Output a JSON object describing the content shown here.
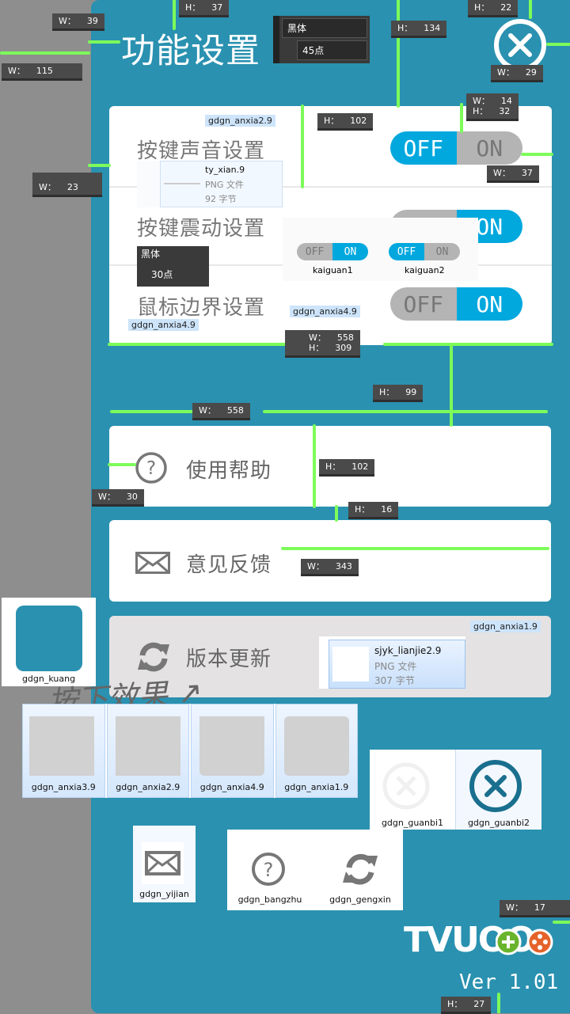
{
  "title": "功能设置",
  "close_icon": "close-circle-icon",
  "font_panel_large": {
    "font": "黑体",
    "size": "45点"
  },
  "font_panel_small": {
    "font": "黑体",
    "size": "30点"
  },
  "settings": [
    {
      "label": "按键声音设置",
      "off": "OFF",
      "on": "ON",
      "state": "off"
    },
    {
      "label": "按键震动设置",
      "off": "OFF",
      "on": "ON",
      "state": "on"
    },
    {
      "label": "鼠标边界设置",
      "off": "OFF",
      "on": "ON",
      "state": "on"
    }
  ],
  "buttons": [
    {
      "label": "使用帮助",
      "icon": "help-circle-icon"
    },
    {
      "label": "意见反馈",
      "icon": "envelope-icon"
    },
    {
      "label": "版本更新",
      "icon": "refresh-icon"
    }
  ],
  "file_labels": {
    "anxia2": "gdgn_anxia2.9",
    "anxia4a": "gdgn_anxia4.9",
    "anxia4b": "gdgn_anxia4.9",
    "anxia1": "gdgn_anxia1.9"
  },
  "ty_xian": {
    "name": "ty_xian.9",
    "type": "PNG 文件",
    "size": "92 字节"
  },
  "sjyk": {
    "name": "sjyk_lianjie2.9",
    "type": "PNG 文件",
    "size": "307 字节"
  },
  "kaiguan": [
    {
      "name": "kaiguan1",
      "off": "OFF",
      "on": "ON"
    },
    {
      "name": "kaiguan2",
      "off": "OFF",
      "on": "ON"
    }
  ],
  "kuang": "gdgn_kuang",
  "handwriting": "按下效果 ↗",
  "anxia_tiles": [
    "gdgn_anxia3.9",
    "gdgn_anxia2.9",
    "gdgn_anxia4.9",
    "gdgn_anxia1.9"
  ],
  "guanbi_tiles": [
    "gdgn_guanbi1",
    "gdgn_guanbi2"
  ],
  "yijian": "gdgn_yijian",
  "icon_tiles": [
    "gdgn_bangzhu",
    "gdgn_gengxin"
  ],
  "logo": "TVUOO",
  "version": "Ver 1.01",
  "measurements": [
    "W：    39",
    "H：    37",
    "W：    115",
    "H：    134",
    "H：    22",
    "W：    29",
    "W：    14\nH：    32",
    "H：    102",
    "W：    37",
    "W：    23",
    "W：    558\nH：    309",
    "H：    99",
    "W：    558",
    "H：    102",
    "W：    30",
    "H：    16",
    "W：    343",
    "W：    17",
    "H：    27"
  ],
  "colors": {
    "panel": "#2a91b0",
    "toggle_on": "#00a8de",
    "toggle_off": "#b4b4b4",
    "update_bg": "#e4e2e3",
    "measure_arrow": "#7dfc5a"
  }
}
